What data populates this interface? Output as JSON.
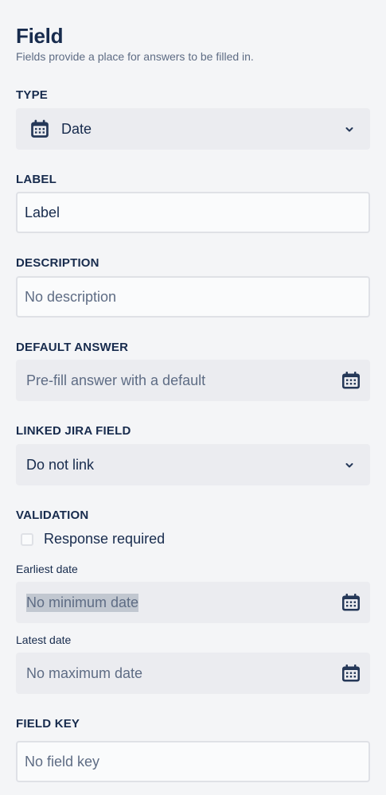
{
  "header": {
    "title": "Field",
    "subtitle": "Fields provide a place for answers to be filled in."
  },
  "type": {
    "label": "TYPE",
    "value": "Date",
    "icon": "calendar-icon"
  },
  "label_field": {
    "label": "LABEL",
    "value": "Label"
  },
  "description": {
    "label": "DESCRIPTION",
    "placeholder": "No description"
  },
  "default_answer": {
    "label": "DEFAULT ANSWER",
    "placeholder": "Pre-fill answer with a default",
    "icon": "calendar-icon"
  },
  "linked_jira_field": {
    "label": "LINKED JIRA FIELD",
    "value": "Do not link"
  },
  "validation": {
    "label": "VALIDATION",
    "response_required_label": "Response required",
    "response_required": false,
    "earliest_date_label": "Earliest date",
    "earliest_date_placeholder": "No minimum date",
    "latest_date_label": "Latest date",
    "latest_date_placeholder": "No maximum date"
  },
  "field_key": {
    "label": "FIELD KEY",
    "placeholder": "No field key"
  },
  "colors": {
    "background": "#f4f5f7",
    "text": "#172b4d",
    "subtle_text": "#5e6c84",
    "input_gray": "#ebecf0",
    "border": "#dfe1e6"
  }
}
